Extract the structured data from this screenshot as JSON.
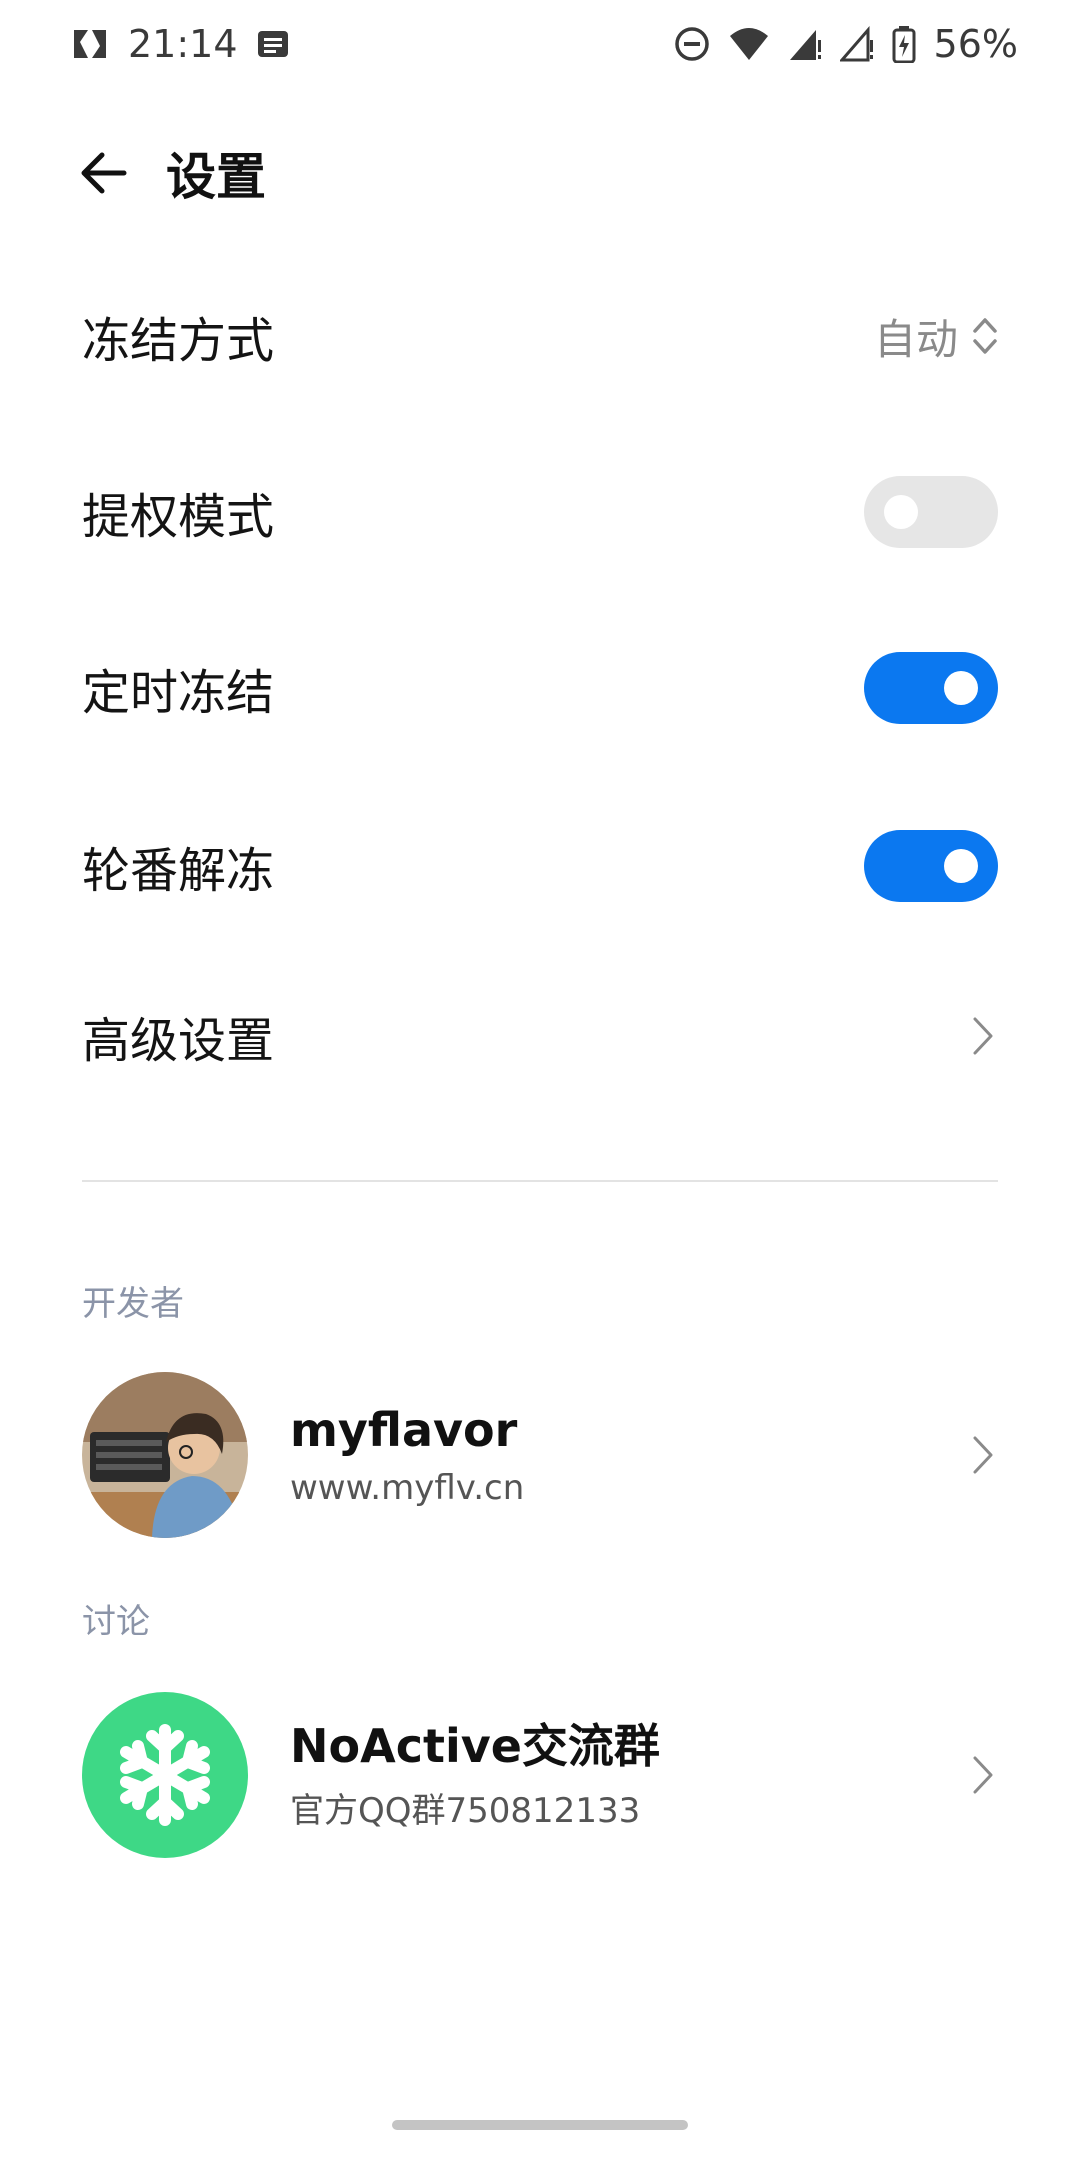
{
  "status_bar": {
    "time": "21:14",
    "battery": "56%",
    "icons": [
      "nfc-icon",
      "message-icon",
      "dnd-icon",
      "wifi-icon",
      "signal-icon",
      "signal-icon",
      "battery-icon"
    ]
  },
  "header": {
    "title": "设置",
    "back_icon": "arrow-left-icon"
  },
  "settings": {
    "freeze_mode": {
      "label": "冻结方式",
      "value": "自动",
      "icon": "up-down-chevron-icon"
    },
    "privilege_mode": {
      "label": "提权模式",
      "enabled": false
    },
    "scheduled_freeze": {
      "label": "定时冻结",
      "enabled": true
    },
    "rotation_unfreeze": {
      "label": "轮番解冻",
      "enabled": true
    },
    "advanced": {
      "label": "高级设置",
      "icon": "chevron-right-icon"
    }
  },
  "developer": {
    "section_label": "开发者",
    "name": "myflavor",
    "site": "www.myflv.cn"
  },
  "discussion": {
    "section_label": "讨论",
    "name": "NoActive交流群",
    "desc": "官方QQ群750812133",
    "icon": "snowflake-icon"
  },
  "colors": {
    "accent": "#0b78f0",
    "toggle_off": "#e6e6e6",
    "green": "#3ed886",
    "section_label": "#8b94a8"
  }
}
